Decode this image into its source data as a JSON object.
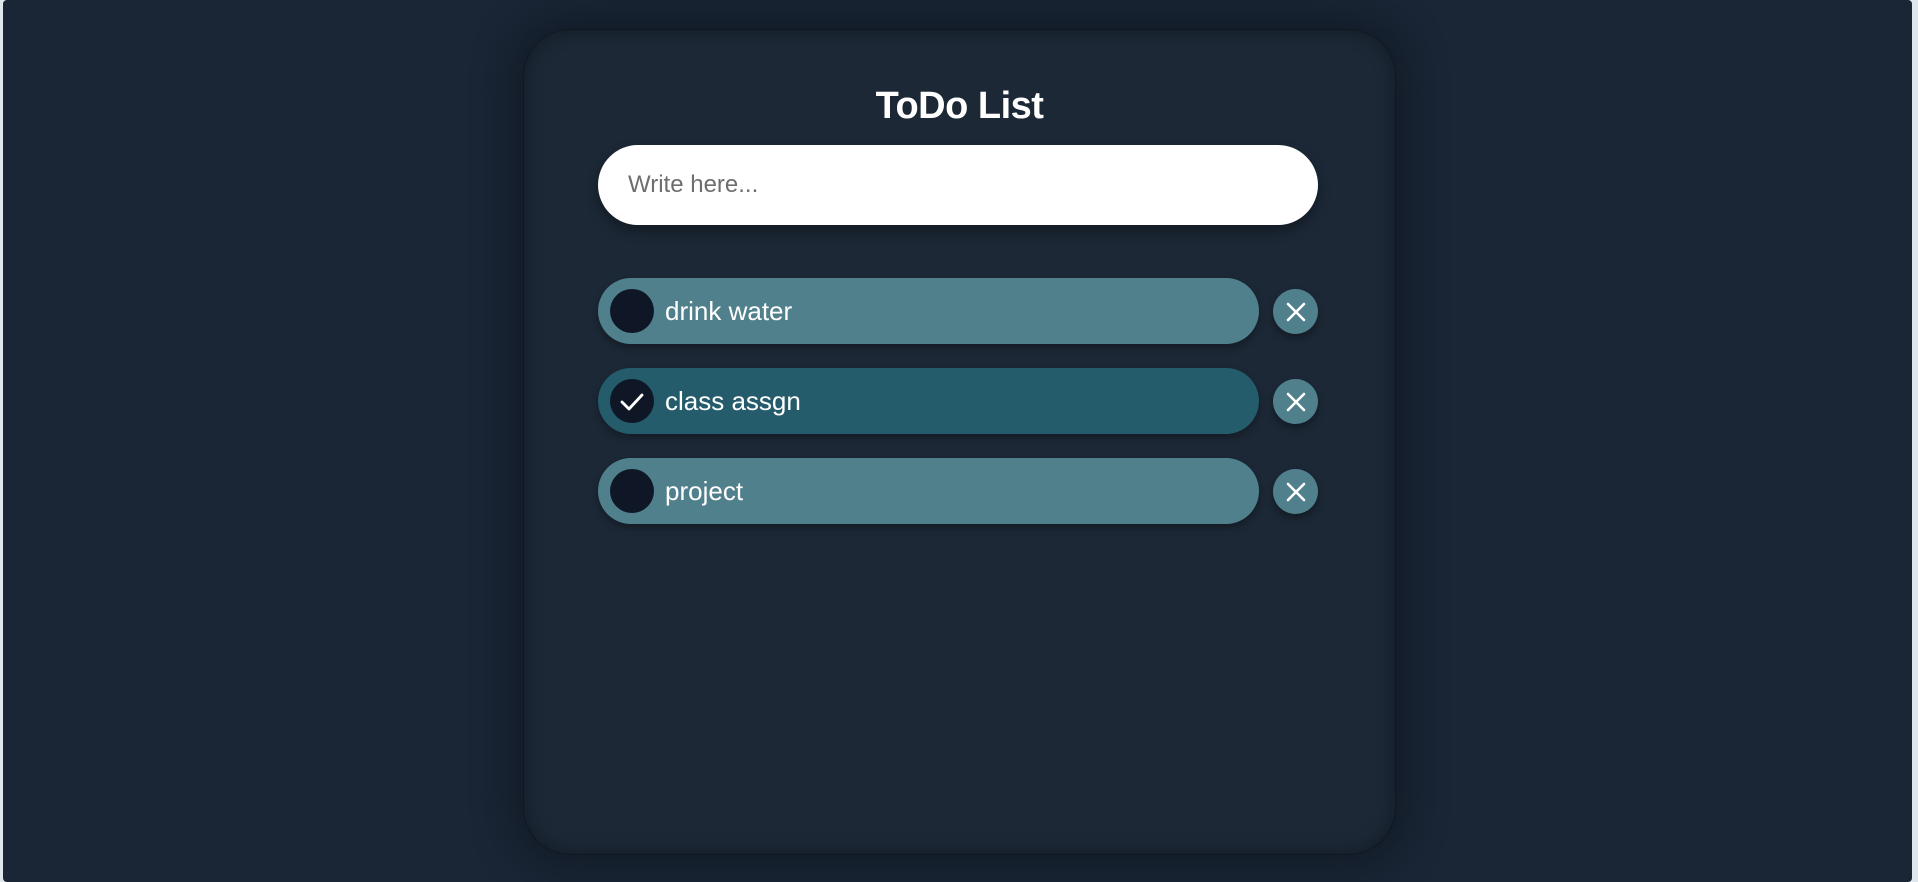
{
  "title": "ToDo List",
  "input": {
    "value": "",
    "placeholder": "Write here..."
  },
  "todos": [
    {
      "text": "drink water",
      "checked": false,
      "icon": "empty-circle"
    },
    {
      "text": "class assgn",
      "checked": true,
      "icon": "checkmark-icon"
    },
    {
      "text": "project",
      "checked": false,
      "icon": "empty-circle"
    }
  ],
  "delete_icon": "close-icon",
  "colors": {
    "page_background": "#1a2535",
    "card_background": "#1c2836",
    "item_unchecked": "#51808d",
    "item_checked": "#245c6b",
    "checkbox": "#0f1727",
    "delete_button": "#51808d",
    "text": "#ffffff"
  }
}
